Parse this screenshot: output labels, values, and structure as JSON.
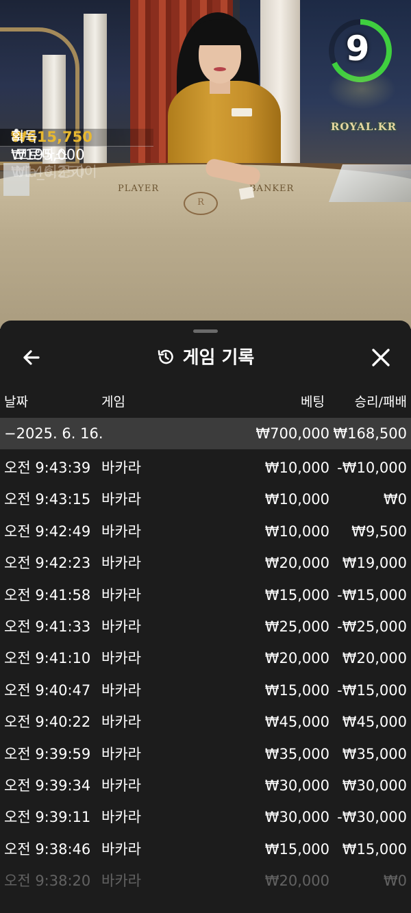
{
  "stream": {
    "timer": "9",
    "brand": "ROYAL.KR",
    "table_labels": {
      "player": "PLAYER",
      "banker": "BANKER",
      "crest": "R"
    },
    "ticker": [
      {
        "count": "8",
        "amount": "₩615,750",
        "suffix": "획득"
      },
      {
        "amount": "₩195,000",
        "name": "크로마스"
      },
      {
        "amount": "₩146,250",
        "name": "bla_희준키이"
      }
    ]
  },
  "sheet": {
    "title": "게임 기록",
    "back_icon": "arrow-left-icon",
    "close_icon": "close-icon",
    "columns": {
      "date": "날짜",
      "game": "게임",
      "bet": "베팅",
      "result": "승리/패배"
    },
    "summary": {
      "date": "−2025. 6. 16.",
      "bet": "₩700,000",
      "result": "₩168,500"
    },
    "rows": [
      {
        "time": "오전 9:43:39",
        "game": "바카라",
        "bet": "₩10,000",
        "result": "-₩10,000"
      },
      {
        "time": "오전 9:43:15",
        "game": "바카라",
        "bet": "₩10,000",
        "result": "₩0"
      },
      {
        "time": "오전 9:42:49",
        "game": "바카라",
        "bet": "₩10,000",
        "result": "₩9,500"
      },
      {
        "time": "오전 9:42:23",
        "game": "바카라",
        "bet": "₩20,000",
        "result": "₩19,000"
      },
      {
        "time": "오전 9:41:58",
        "game": "바카라",
        "bet": "₩15,000",
        "result": "-₩15,000"
      },
      {
        "time": "오전 9:41:33",
        "game": "바카라",
        "bet": "₩25,000",
        "result": "-₩25,000"
      },
      {
        "time": "오전 9:41:10",
        "game": "바카라",
        "bet": "₩20,000",
        "result": "₩20,000"
      },
      {
        "time": "오전 9:40:47",
        "game": "바카라",
        "bet": "₩15,000",
        "result": "-₩15,000"
      },
      {
        "time": "오전 9:40:22",
        "game": "바카라",
        "bet": "₩45,000",
        "result": "₩45,000"
      },
      {
        "time": "오전 9:39:59",
        "game": "바카라",
        "bet": "₩35,000",
        "result": "₩35,000"
      },
      {
        "time": "오전 9:39:34",
        "game": "바카라",
        "bet": "₩30,000",
        "result": "₩30,000"
      },
      {
        "time": "오전 9:39:11",
        "game": "바카라",
        "bet": "₩30,000",
        "result": "-₩30,000"
      },
      {
        "time": "오전 9:38:46",
        "game": "바카라",
        "bet": "₩15,000",
        "result": "₩15,000"
      },
      {
        "time": "오전 9:38:20",
        "game": "바카라",
        "bet": "₩20,000",
        "result": "₩0"
      }
    ]
  }
}
